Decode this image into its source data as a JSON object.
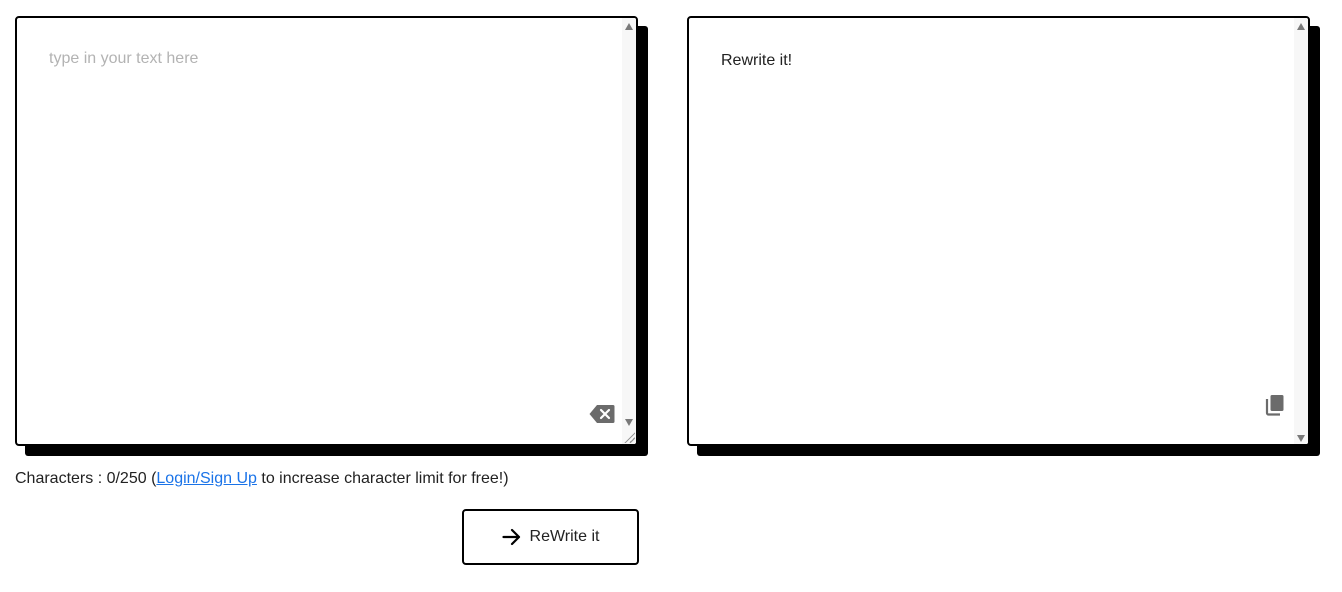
{
  "input_panel": {
    "placeholder": "type in your text here",
    "value": "",
    "clear_icon": "backspace-clear-icon"
  },
  "output_panel": {
    "text": "Rewrite it!",
    "copy_icon": "copy-icon"
  },
  "character_counter": {
    "prefix": "Characters : 0/250 (",
    "link_text": "Login/Sign Up",
    "suffix": " to increase character limit for free!)"
  },
  "rewrite_button": {
    "label": "ReWrite it",
    "icon": "arrow-right-icon"
  },
  "colors": {
    "border": "#000000",
    "shadow": "#000000",
    "link": "#1a73e8",
    "placeholder": "#b3b3b3"
  }
}
